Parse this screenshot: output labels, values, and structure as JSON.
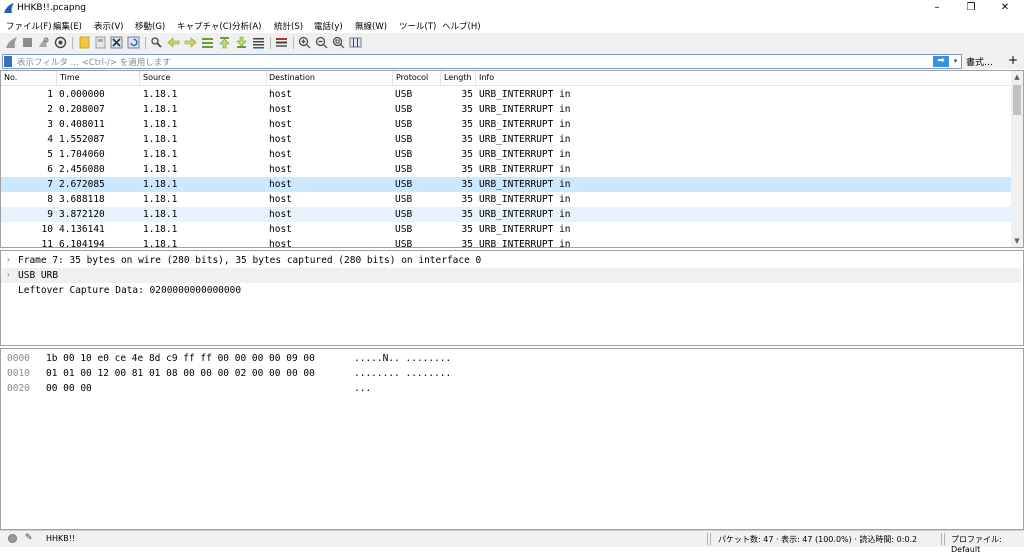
{
  "window": {
    "title": "HHKB!!.pcapng",
    "controls": [
      "–",
      "❐",
      "✕"
    ]
  },
  "menu": [
    "ファイル(F)",
    "編集(E)",
    "表示(V)",
    "移動(G)",
    "キャプチャ(C)",
    "分析(A)",
    "統計(S)",
    "電話(y)",
    "無線(W)",
    "ツール(T)",
    "ヘルプ(H)"
  ],
  "filter": {
    "placeholder": "表示フィルタ … <Ctrl-/> を適用します",
    "apply_arrow": "➡",
    "dropdown": "▾",
    "format_label": "書式…",
    "add": "+"
  },
  "packet_list": {
    "columns": [
      "No.",
      "Time",
      "Source",
      "Destination",
      "Protocol",
      "Length",
      "Info"
    ],
    "rows": [
      {
        "no": "1",
        "time": "0.000000",
        "source": "1.18.1",
        "destination": "host",
        "protocol": "USB",
        "length": "35",
        "info": "URB_INTERRUPT in"
      },
      {
        "no": "2",
        "time": "0.208007",
        "source": "1.18.1",
        "destination": "host",
        "protocol": "USB",
        "length": "35",
        "info": "URB_INTERRUPT in"
      },
      {
        "no": "3",
        "time": "0.408011",
        "source": "1.18.1",
        "destination": "host",
        "protocol": "USB",
        "length": "35",
        "info": "URB_INTERRUPT in"
      },
      {
        "no": "4",
        "time": "1.552087",
        "source": "1.18.1",
        "destination": "host",
        "protocol": "USB",
        "length": "35",
        "info": "URB_INTERRUPT in"
      },
      {
        "no": "5",
        "time": "1.704060",
        "source": "1.18.1",
        "destination": "host",
        "protocol": "USB",
        "length": "35",
        "info": "URB_INTERRUPT in"
      },
      {
        "no": "6",
        "time": "2.456080",
        "source": "1.18.1",
        "destination": "host",
        "protocol": "USB",
        "length": "35",
        "info": "URB_INTERRUPT in"
      },
      {
        "no": "7",
        "time": "2.672085",
        "source": "1.18.1",
        "destination": "host",
        "protocol": "USB",
        "length": "35",
        "info": "URB_INTERRUPT in"
      },
      {
        "no": "8",
        "time": "3.688118",
        "source": "1.18.1",
        "destination": "host",
        "protocol": "USB",
        "length": "35",
        "info": "URB_INTERRUPT in"
      },
      {
        "no": "9",
        "time": "3.872120",
        "source": "1.18.1",
        "destination": "host",
        "protocol": "USB",
        "length": "35",
        "info": "URB_INTERRUPT in"
      },
      {
        "no": "10",
        "time": "4.136141",
        "source": "1.18.1",
        "destination": "host",
        "protocol": "USB",
        "length": "35",
        "info": "URB_INTERRUPT in"
      },
      {
        "no": "11",
        "time": "6.104194",
        "source": "1.18.1",
        "destination": "host",
        "protocol": "USB",
        "length": "35",
        "info": "URB_INTERRUPT in"
      }
    ],
    "selected_index": 6,
    "scroll_up": "▲",
    "scroll_down": "▼"
  },
  "details": {
    "rows": [
      {
        "arrow": "›",
        "text": "Frame 7: 35 bytes on wire (280 bits), 35 bytes captured (280 bits) on interface 0"
      },
      {
        "arrow": "›",
        "text": "USB URB"
      },
      {
        "arrow": "",
        "text": "Leftover Capture Data: 0200000000000000"
      }
    ]
  },
  "bytes": {
    "rows": [
      {
        "offset": "0000",
        "hex": "1b 00 10 e0 ce 4e 8d c9  ff ff 00 00 00 00 09 00",
        "ascii": ".....N.. ........"
      },
      {
        "offset": "0010",
        "hex": "01 01 00 12 00 81 01 08  00 00 00 02 00 00 00 00",
        "ascii": "........ ........"
      },
      {
        "offset": "0020",
        "hex": "00 00 00",
        "ascii": "..."
      }
    ]
  },
  "status": {
    "file": "HHKB!!",
    "packets": "パケット数: 47 · 表示: 47 (100.0%) · 読込時間: 0:0.2",
    "profile": "プロファイル: Default",
    "pen_icon": "✎"
  },
  "colors": {
    "selected_row": "#cce8ff",
    "alt_row": "#e6f3ff",
    "accent": "#3b8fe0"
  }
}
